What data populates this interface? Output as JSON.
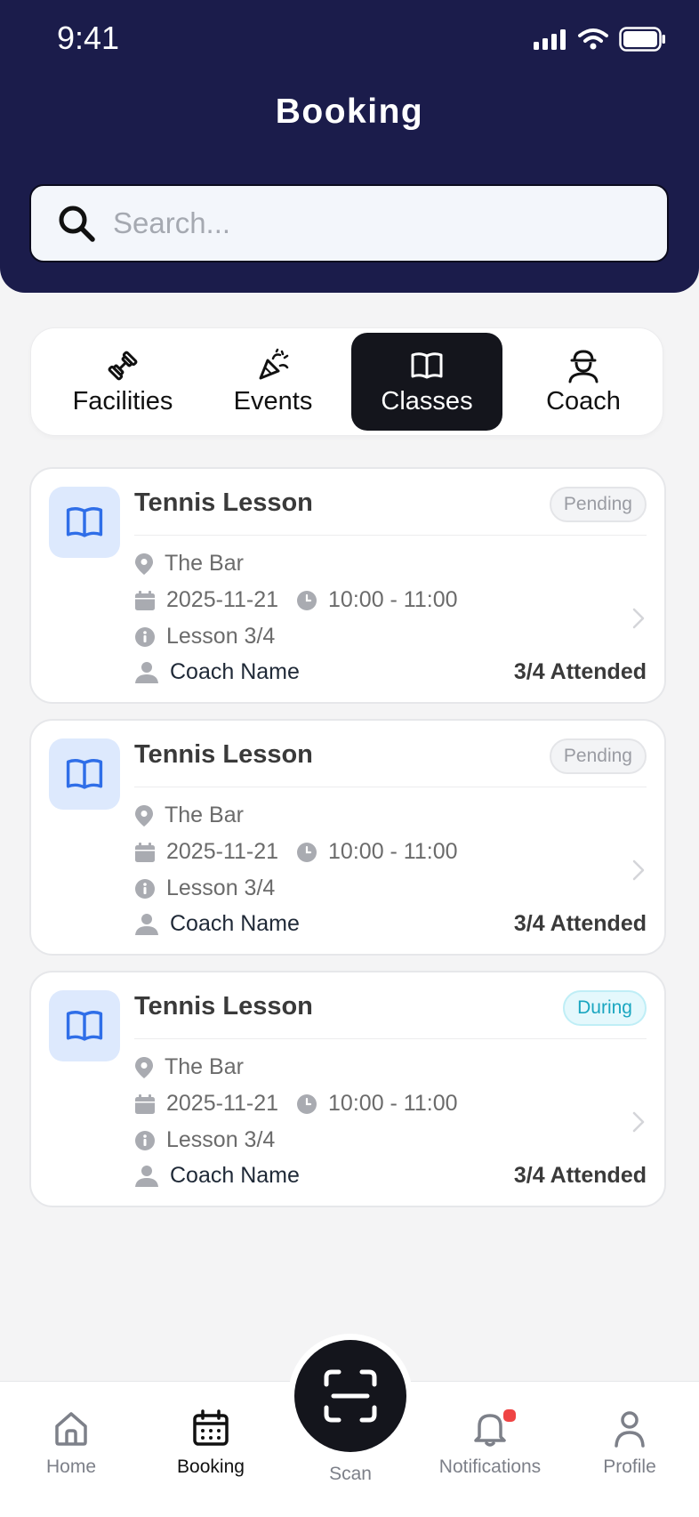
{
  "status_bar": {
    "time": "9:41"
  },
  "header": {
    "title": "Booking",
    "search": {
      "placeholder": "Search...",
      "value": ""
    }
  },
  "tabs": [
    {
      "label": "Facilities",
      "icon": "dumbbell-icon"
    },
    {
      "label": "Events",
      "icon": "party-popper-icon"
    },
    {
      "label": "Classes",
      "icon": "book-icon",
      "active": true
    },
    {
      "label": "Coach",
      "icon": "coach-icon"
    }
  ],
  "bookings": [
    {
      "title": "Tennis Lesson",
      "status": "Pending",
      "location": "The Bar",
      "date": "2025-11-21",
      "time": "10:00 - 11:00",
      "lesson": "Lesson 3/4",
      "coach": "Coach Name",
      "attended": "3/4 Attended"
    },
    {
      "title": "Tennis Lesson",
      "status": "Pending",
      "location": "The Bar",
      "date": "2025-11-21",
      "time": "10:00 - 11:00",
      "lesson": "Lesson 3/4",
      "coach": "Coach Name",
      "attended": "3/4 Attended"
    },
    {
      "title": "Tennis Lesson",
      "status": "During",
      "location": "The Bar",
      "date": "2025-11-21",
      "time": "10:00 - 11:00",
      "lesson": "Lesson 3/4",
      "coach": "Coach Name",
      "attended": "3/4 Attended"
    }
  ],
  "bottom_nav": {
    "home": "Home",
    "booking": "Booking",
    "scan": "Scan",
    "notifications": "Notifications",
    "profile": "Profile",
    "active": "booking"
  },
  "colors": {
    "header_bg": "#1b1c4b",
    "accent_dark": "#14151c",
    "icon_blue": "#2f6ee8",
    "pending_text": "#9a9ca3",
    "during_text": "#1aa6c0",
    "notification_dot": "#ef4444"
  }
}
